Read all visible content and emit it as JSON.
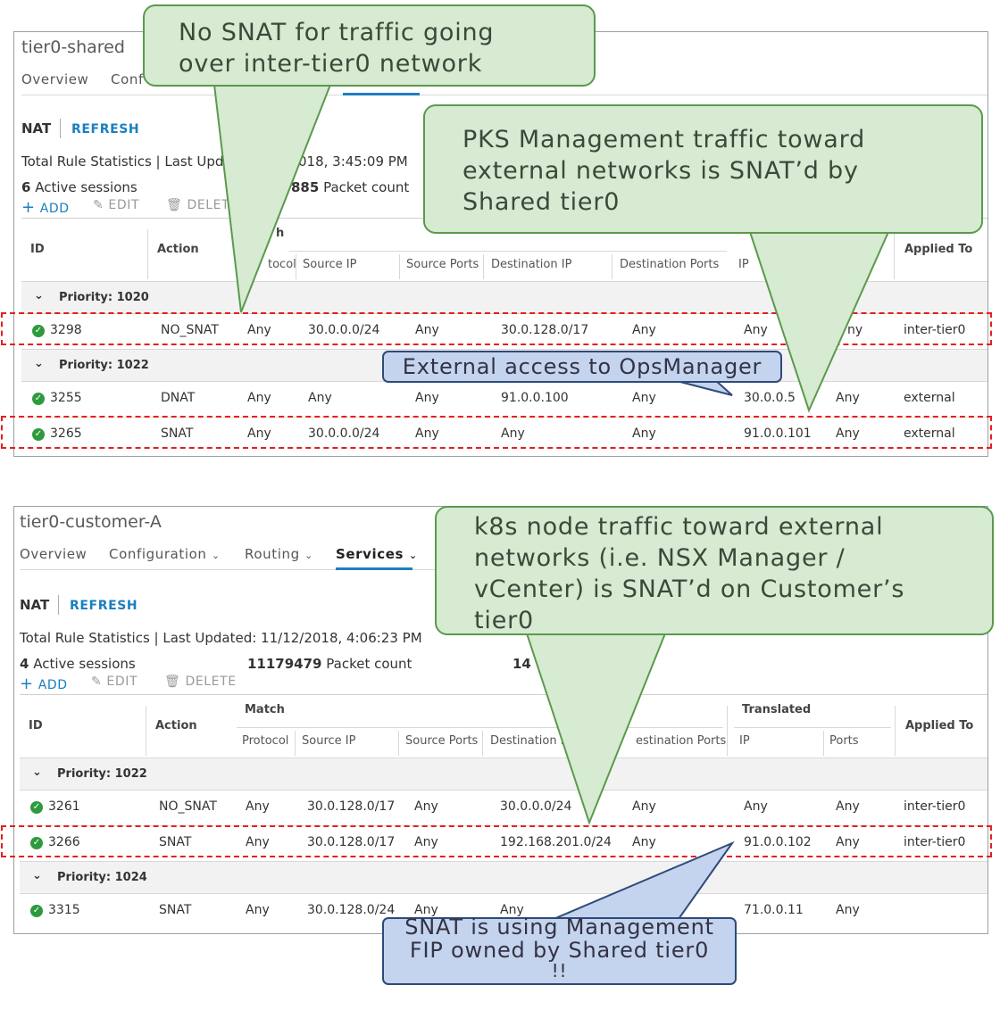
{
  "panel1": {
    "title": "tier0-shared",
    "tabs": [
      "Overview",
      "Conf"
    ],
    "nat_label": "NAT",
    "refresh_label": "REFRESH",
    "stats": "Total Rule Statistics | Last Upda",
    "stats_date": "018, 3:45:09 PM",
    "sessions_count": "6",
    "sessions_label": "Active sessions",
    "packet_count": "885",
    "packet_label": "Packet count",
    "add_label": "ADD",
    "edit_label": "EDIT",
    "delete_label": "DELET",
    "headers": {
      "id": "ID",
      "action": "Action",
      "match_fragment": "h",
      "protocol": "tocol",
      "source_ip": "Source IP",
      "source_ports": "Source Ports",
      "destination_ip": "Destination IP",
      "destination_ports": "Destination Ports",
      "ip": "IP",
      "applied_to": "Applied To"
    },
    "groups": [
      {
        "priority": "Priority: 1020",
        "rows": [
          {
            "id": "3298",
            "action": "NO_SNAT",
            "protocol": "Any",
            "source_ip": "30.0.0.0/24",
            "source_ports": "Any",
            "destination_ip": "30.0.128.0/17",
            "destination_ports": "Any",
            "ip": "Any",
            "ports": "ny",
            "applied_to": "inter-tier0"
          }
        ]
      },
      {
        "priority": "Priority: 1022",
        "rows": [
          {
            "id": "3255",
            "action": "DNAT",
            "protocol": "Any",
            "source_ip": "Any",
            "source_ports": "Any",
            "destination_ip": "91.0.0.100",
            "destination_ports": "Any",
            "ip": "30.0.0.5",
            "ports": "Any",
            "applied_to": "external"
          },
          {
            "id": "3265",
            "action": "SNAT",
            "protocol": "Any",
            "source_ip": "30.0.0.0/24",
            "source_ports": "Any",
            "destination_ip": "Any",
            "destination_ports": "Any",
            "ip": "91.0.0.101",
            "ports": "Any",
            "applied_to": "external"
          }
        ]
      }
    ]
  },
  "panel2": {
    "title": "tier0-customer-A",
    "tabs": [
      "Overview",
      "Configuration",
      "Routing",
      "Services"
    ],
    "nat_label": "NAT",
    "refresh_label": "REFRESH",
    "stats": "Total Rule Statistics | Last Updated: 11/12/2018, 4:06:23 PM",
    "sessions_count": "4",
    "sessions_label": "Active sessions",
    "packet_count": "11179479",
    "packet_label": "Packet count",
    "extra_fragment": "14",
    "add_label": "ADD",
    "edit_label": "EDIT",
    "delete_label": "DELETE",
    "headers": {
      "id": "ID",
      "action": "Action",
      "match": "Match",
      "protocol": "Protocol",
      "source_ip": "Source IP",
      "source_ports": "Source Ports",
      "destination_ip": "Destination I",
      "destination_ports": "estination Ports",
      "translated": "Translated",
      "ip": "IP",
      "ports": "Ports",
      "applied_to": "Applied To"
    },
    "groups": [
      {
        "priority": "Priority: 1022",
        "rows": [
          {
            "id": "3261",
            "action": "NO_SNAT",
            "protocol": "Any",
            "source_ip": "30.0.128.0/17",
            "source_ports": "Any",
            "destination_ip": "30.0.0.0/24",
            "destination_ports": "Any",
            "ip": "Any",
            "ports": "Any",
            "applied_to": "inter-tier0"
          },
          {
            "id": "3266",
            "action": "SNAT",
            "protocol": "Any",
            "source_ip": "30.0.128.0/17",
            "source_ports": "Any",
            "destination_ip": "192.168.201.0/24",
            "destination_ports": "Any",
            "ip": "91.0.0.102",
            "ports": "Any",
            "applied_to": "inter-tier0"
          }
        ]
      },
      {
        "priority": "Priority: 1024",
        "rows": [
          {
            "id": "3315",
            "action": "SNAT",
            "protocol": "Any",
            "source_ip": "30.0.128.0/24",
            "source_ports": "Any",
            "destination_ip": "Any",
            "destination_ports": "",
            "ip": "71.0.0.11",
            "ports": "Any",
            "applied_to": ""
          }
        ]
      }
    ]
  },
  "callouts": {
    "no_snat": [
      "No SNAT for traffic going",
      "over inter-tier0 network"
    ],
    "pks_mgmt": [
      "PKS Management traffic toward",
      "external networks is SNAT’d by",
      "Shared tier0"
    ],
    "external_access": "External access to OpsManager",
    "k8s_node": [
      "k8s node traffic toward external",
      "networks (i.e. NSX Manager /",
      "vCenter) is SNAT’d on Customer’s",
      "tier0"
    ],
    "snat_fip": [
      "SNAT is using Management",
      "FIP owned by Shared tier0",
      "!!"
    ]
  },
  "colors": {
    "callout_green": "#d7ead2",
    "callout_green_border": "#5a9a4c",
    "callout_blue": "#c5d4ee",
    "callout_blue_border": "#2e4a7a",
    "highlight_dash": "#e41f1f",
    "link_blue": "#1a7fbf",
    "status_ok": "#2e9a3e"
  },
  "icons": [
    "plus-icon",
    "pencil-icon",
    "trash-icon",
    "chevron-down-icon",
    "check-circle-icon"
  ]
}
